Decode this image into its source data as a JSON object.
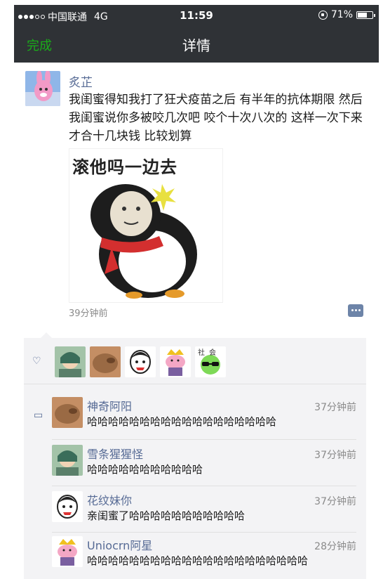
{
  "status_bar": {
    "carrier": "中国联通",
    "network": "4G",
    "time": "11:59",
    "battery": "71%",
    "battery_level": 0.71
  },
  "nav": {
    "done_label": "完成",
    "title": "详情"
  },
  "post": {
    "author": "炙芷",
    "text": "我闺蜜得知我打了狂犬疫苗之后 有半年的抗体期限 然后我闺蜜说你多被咬几次吧 咬个十次八次的 这样一次下来才合十几块钱 比较划算",
    "image_caption": "滚他吗一边去",
    "time_ago": "39分钟前"
  },
  "likes": {
    "icon": "heart-icon",
    "avatar_badge": "社会"
  },
  "comments": [
    {
      "name": "神奇阿阳",
      "time": "37分钟前",
      "text": "哈哈哈哈哈哈哈哈哈哈哈哈哈哈哈哈哈哈"
    },
    {
      "name": "雪条猩猩怪",
      "time": "37分钟前",
      "text": "哈哈哈哈哈哈哈哈哈哈哈"
    },
    {
      "name": "花纹妹你",
      "time": "37分钟前",
      "text": "亲闺蜜了哈哈哈哈哈哈哈哈哈哈哈"
    },
    {
      "name": "Uniocrn阿星",
      "time": "28分钟前",
      "text": "哈哈哈哈哈哈哈哈哈哈哈哈哈哈哈哈哈哈哈哈哈"
    }
  ],
  "colors": {
    "bar": "#2f3236",
    "accent_green": "#1aad19",
    "link_blue": "#576b95"
  }
}
